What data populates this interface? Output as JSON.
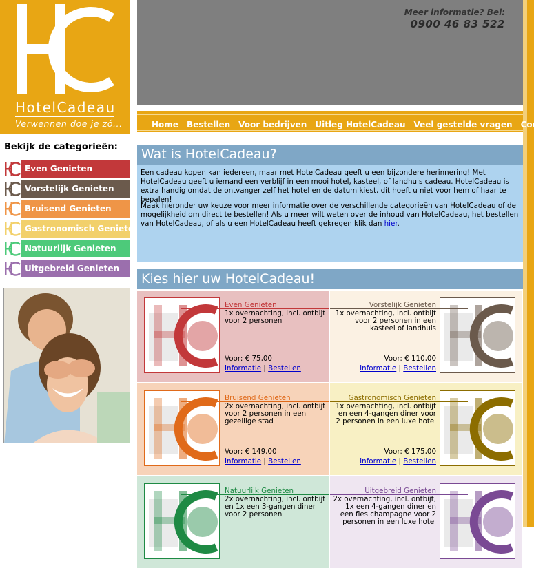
{
  "logo": {
    "brand": "HotelCadeau",
    "slogan": "Verwennen doe je zó..."
  },
  "contact": {
    "label": "Meer informatie? Bel:",
    "phone": "0900 46 83 522"
  },
  "nav": [
    "Home",
    "Bestellen",
    "Voor bedrijven",
    "Uitleg HotelCadeau",
    "Veel gestelde vragen",
    "Contact"
  ],
  "sidebar": {
    "title": "Bekijk de categorieën:",
    "categories": [
      {
        "label": "Even Genieten",
        "color": "#c2383a"
      },
      {
        "label": "Vorstelijk Genieten",
        "color": "#6b5a4c"
      },
      {
        "label": "Bruisend Genieten",
        "color": "#ef9547"
      },
      {
        "label": "Gastronomisch Genieten",
        "color": "#f2d06b"
      },
      {
        "label": "Natuurlijk Genieten",
        "color": "#4dca7a"
      },
      {
        "label": "Uitgebreid Genieten",
        "color": "#9b6fad"
      }
    ]
  },
  "intro": {
    "heading": "Wat is HotelCadeau?",
    "p1": "Een cadeau kopen kan iedereen, maar met HotelCadeau geeft u een bijzondere herinnering! Met HotelCadeau geeft u iemand een verblijf in een mooi hotel, kasteel, of landhuis cadeau. HotelCadeau is extra handig omdat de ontvanger zelf het hotel en de datum kiest, dit hoeft u niet voor hem of haar te bepalen!",
    "p2": "Maak hieronder uw keuze voor meer informatie over de verschillende categorieën van HotelCadeau of de mogelijkheid om direct te bestellen! Als u meer wilt weten over de inhoud van HotelCadeau, het bestellen van HotelCadeau, of als u een HotelCadeau heeft gekregen klik dan",
    "p2_link": "hier",
    "p2_end": "."
  },
  "products_heading": "Kies hier uw HotelCadeau!",
  "products": [
    {
      "name": "Even Genieten",
      "desc": "1x overnachting, incl. ontbijt voor 2 personen",
      "price": "Voor: € 75,00",
      "bg": "#e8c0c0",
      "accent": "#c2383a"
    },
    {
      "name": "Vorstelijk Genieten",
      "desc": "1x overnachting, incl. ontbijt voor 2 personen in een kasteel of landhuis",
      "price": "Voor: € 110,00",
      "bg": "#fbf1e3",
      "accent": "#6b5a4c"
    },
    {
      "name": "Bruisend Genieten",
      "desc": "2x overnachting, incl. ontbijt voor 2 personen in een gezellige stad",
      "price": "Voor: € 149,00",
      "bg": "#f7d3b9",
      "accent": "#e06a1a"
    },
    {
      "name": "Gastronomisch Genieten",
      "desc": "1x overnachting, incl. ontbijt en een 4-gangen diner voor 2 personen in een luxe hotel",
      "price": "Voor: € 175,00",
      "bg": "#f8f0c4",
      "accent": "#8c6d00"
    },
    {
      "name": "Natuurlijk Genieten",
      "desc": "2x overnachting, incl. ontbijt en 1x een 3-gangen diner voor 2 personen",
      "price": "",
      "bg": "#cfe7d8",
      "accent": "#1e8a44"
    },
    {
      "name": "Uitgebreid Genieten",
      "desc": "2x overnachting, incl. ontbijt, 1x een 4-gangen diner en een fles champagne voor 2 personen in een luxe hotel",
      "price": "",
      "bg": "#efe6f1",
      "accent": "#7a4a94"
    }
  ],
  "links": {
    "info": "Informatie",
    "sep": "|",
    "order": "Bestellen"
  }
}
